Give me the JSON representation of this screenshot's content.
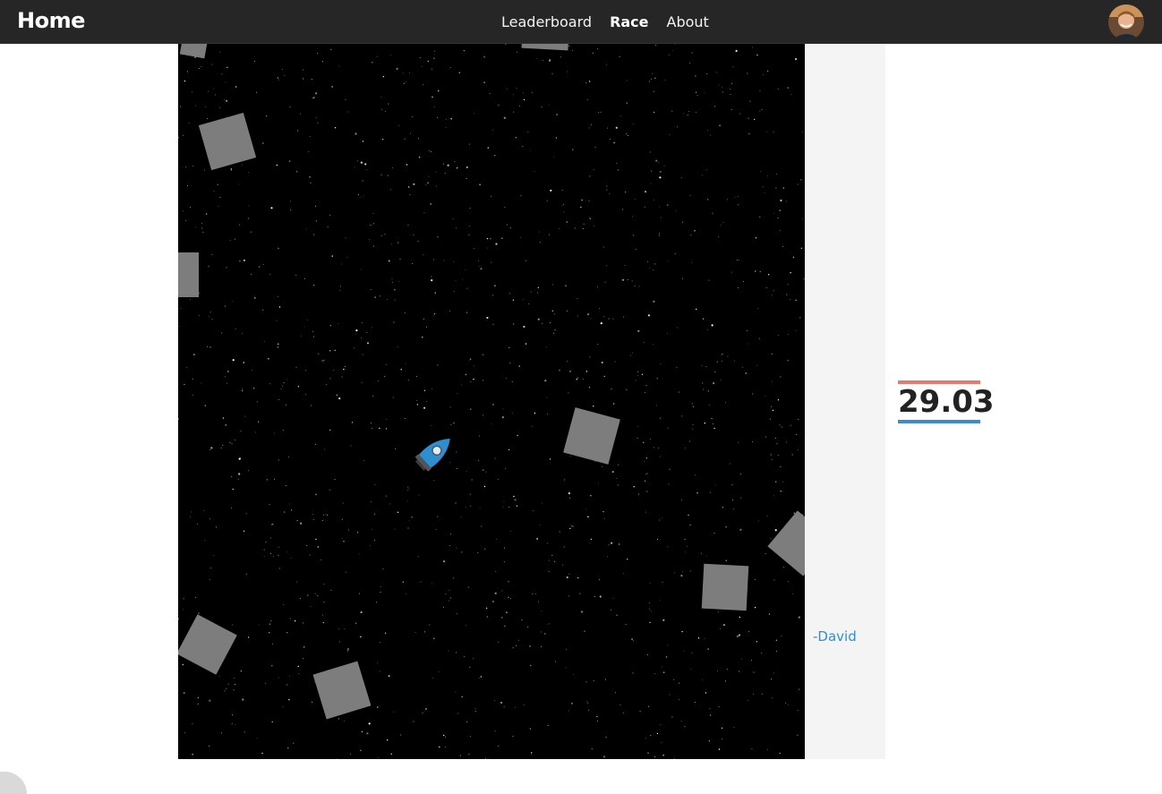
{
  "nav": {
    "brand": "Home",
    "links": [
      {
        "label": "Leaderboard",
        "active": false
      },
      {
        "label": "Race",
        "active": true
      },
      {
        "label": "About",
        "active": false
      }
    ]
  },
  "game": {
    "timer": "29.03",
    "signature": "-David"
  },
  "colors": {
    "navbar": "#262626",
    "space": "#000000",
    "asteroid": "#7d7d7d",
    "rocket": "#2e8fd0",
    "timer_top": "#e57a6e",
    "timer_bottom": "#3a8dc8",
    "signature": "#2e8fd0"
  },
  "icons": {
    "player": "rocket-icon",
    "obstacle": "asteroid-block",
    "avatar": "user-avatar"
  }
}
